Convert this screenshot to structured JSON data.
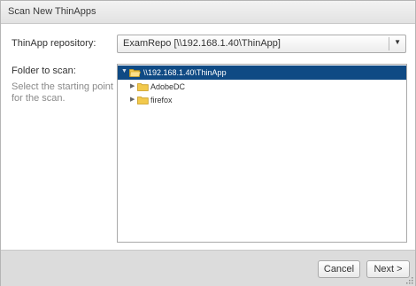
{
  "dialog": {
    "title": "Scan New ThinApps"
  },
  "form": {
    "repository_label": "ThinApp repository:",
    "repository_value": "ExamRepo [\\\\192.168.1.40\\ThinApp]",
    "folder_label": "Folder to scan:",
    "folder_hint": "Select the starting point for the scan."
  },
  "tree": {
    "root": {
      "label": "\\\\192.168.1.40\\ThinApp",
      "expanded": true,
      "selected": true
    },
    "children": [
      {
        "label": "AdobeDC",
        "expanded": false
      },
      {
        "label": "firefox",
        "expanded": false
      }
    ]
  },
  "buttons": {
    "cancel": "Cancel",
    "next": "Next >"
  },
  "icons": {
    "dropdown": "chevron-down-icon",
    "expander_open": "triangle-down-icon",
    "expander_closed": "triangle-right-icon",
    "folder": "folder-icon",
    "resize": "resize-grip-icon"
  },
  "colors": {
    "selection": "#0f4a84",
    "folder": "#f2c94c"
  }
}
